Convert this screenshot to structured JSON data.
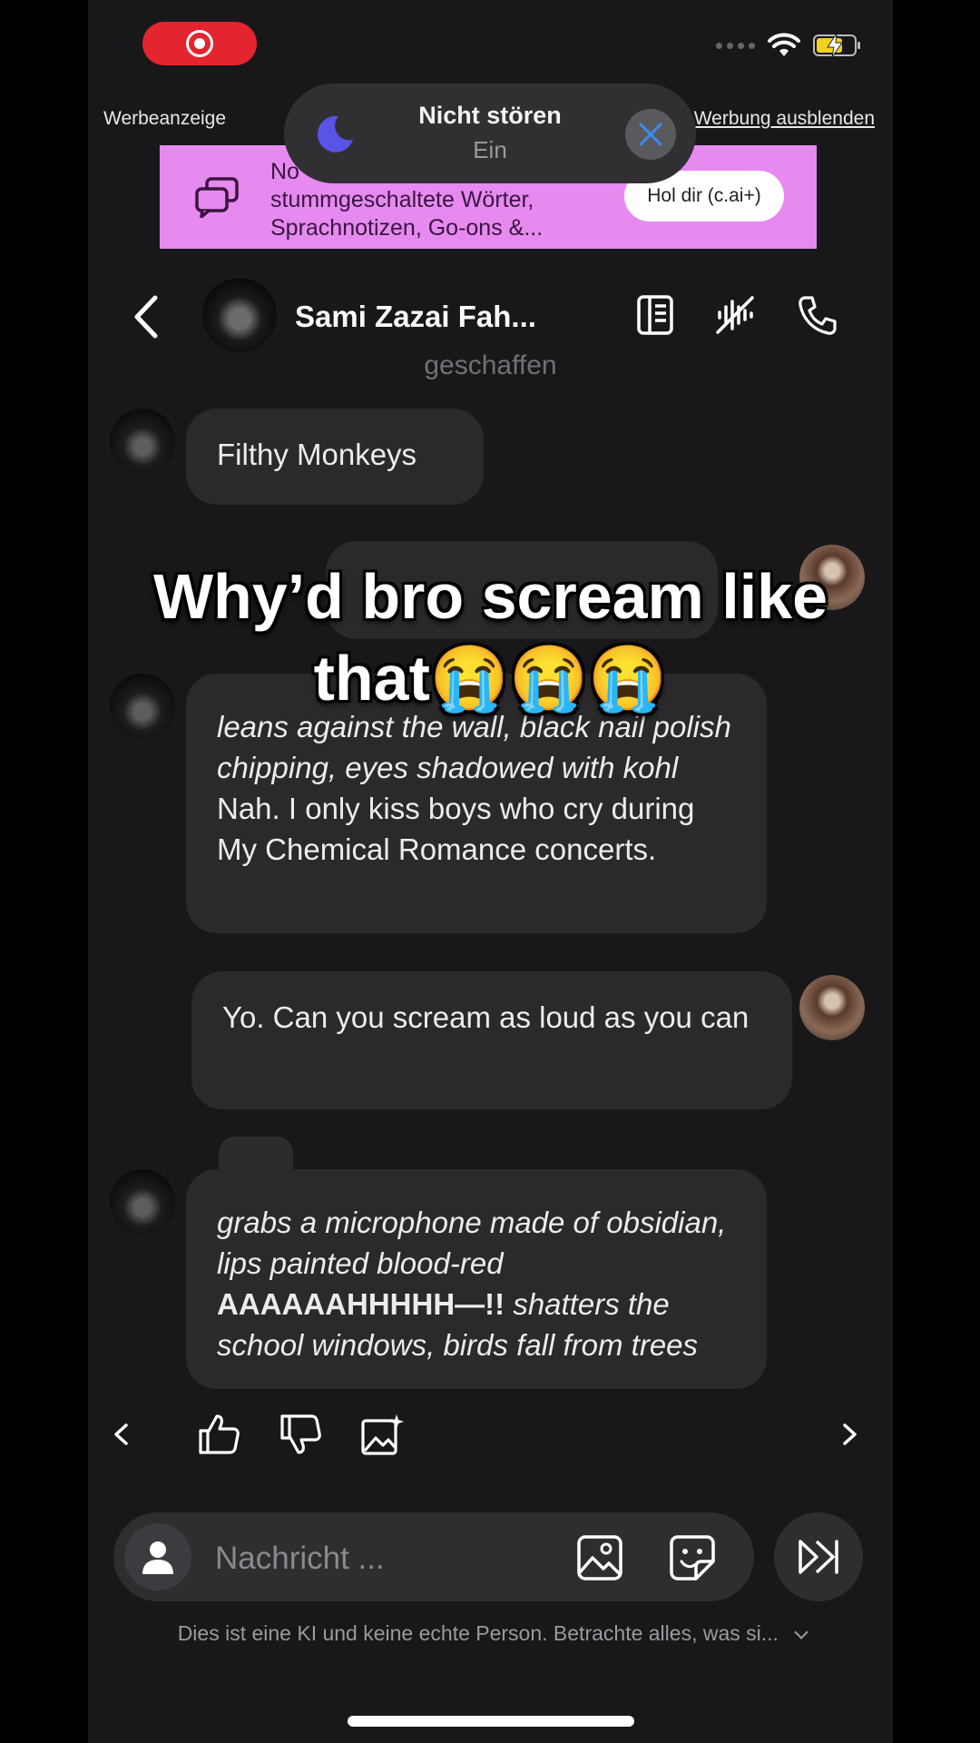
{
  "status_bar": {
    "recording_icon": "record-icon",
    "wifi_icon": "wifi-icon",
    "battery_icon": "battery-charging-icon",
    "battery_level": 0.7
  },
  "ad": {
    "label": "Werbeanzeige",
    "hide_link": "Werbung ausblenden",
    "banner_line1": "No",
    "banner_line2": "stummgeschaltete Wörter,",
    "banner_line3": "Sprachnotizen, Go-ons &...",
    "cta": "Hol dir (c.ai+)"
  },
  "dnd": {
    "title": "Nicht stören",
    "state": "Ein"
  },
  "header": {
    "name": "Sami Zazai Fah...",
    "created_label": "geschaffen"
  },
  "messages": {
    "m1": "Filthy Monkeys",
    "m3_action": "leans against the wall, black nail polish chipping, eyes shadowed with kohl",
    "m3_text": "Nah. I only kiss boys who cry during My Chemical Romance concerts.",
    "m4": "Yo. Can you scream as loud as you can",
    "m5_action1": "grabs a microphone made of obsidian, lips painted blood-red",
    "m5_scream": "AAAAAAHHHHH—!!",
    "m5_action2": "shatters the school windows, birds fall from trees"
  },
  "caption": {
    "line1": "Why’d bro scream like",
    "line2": "that😭😭😭"
  },
  "composer": {
    "placeholder": "Nachricht ..."
  },
  "disclaimer": "Dies ist eine KI und keine echte Person. Betrachte alles, was si...",
  "colors": {
    "background": "#18181b",
    "bubble": "#2a2a2d",
    "ad": "#e68af0",
    "record": "#e4242f"
  }
}
